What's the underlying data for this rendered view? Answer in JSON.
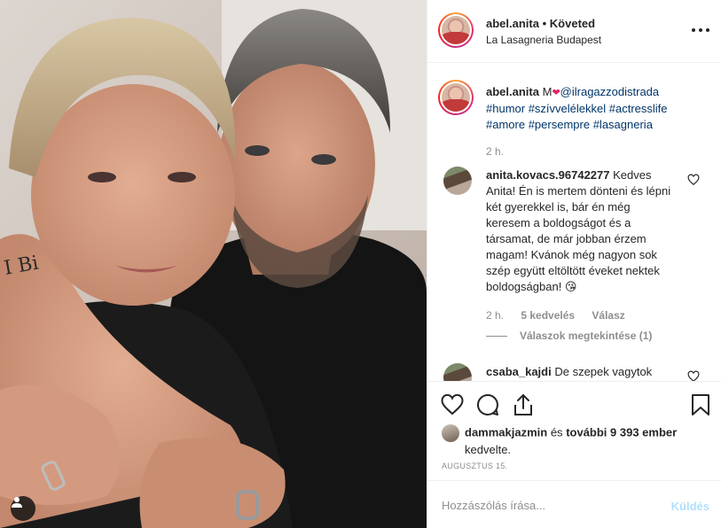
{
  "header": {
    "username": "abel.anita",
    "separator": "•",
    "follow_status": "Követed",
    "location": "La Lasagneria Budapest"
  },
  "caption": {
    "username": "abel.anita",
    "text_before": "M",
    "mention": "@ilragazzodistrada",
    "hashtags": [
      "#humor",
      "#szívvelélekkel",
      "#actresslife",
      "#amore",
      "#persempre",
      "#lasagneria"
    ],
    "time": "2 h."
  },
  "comments": [
    {
      "username": "anita.kovacs.96742277",
      "text": "Kedves Anita! Én is mertem dönteni és lépni két gyerekkel is, bár én még keresem a boldogságot és a társamat, de már jobban érzem magam! Kvánok még nagyon sok szép együtt eltöltött éveket nektek boldogságban! 😘",
      "time": "2 h.",
      "likes": "5 kedvelés",
      "reply": "Válasz",
      "view_replies": "Válaszok megtekintése (1)"
    },
    {
      "username": "csaba_kajdi",
      "text": "De szepek vagytok"
    }
  ],
  "likes": {
    "first_liker": "dammakjazmin",
    "connector": "és",
    "others": "további 9 393 ember",
    "suffix": "kedvelte."
  },
  "date": "AUGUSZTUS 15.",
  "composer": {
    "placeholder": "Hozzászólás írása...",
    "send_label": "Küldés"
  },
  "colors": {
    "link": "#003569",
    "muted": "#8e8e8e",
    "send_disabled": "#b2dffc",
    "border": "#efefef"
  }
}
